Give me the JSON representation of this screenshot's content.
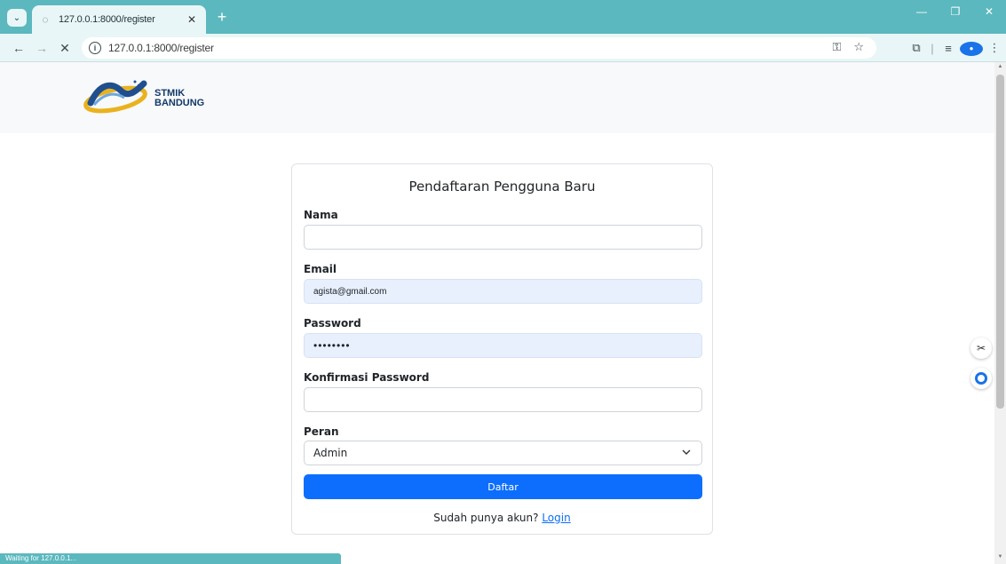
{
  "browser": {
    "tab_title": "127.0.0.1:8000/register",
    "url": "127.0.0.1:8000/register",
    "status_text": "Waiting for 127.0.0.1..."
  },
  "header": {
    "logo_line1": "STMIK",
    "logo_line2": "BANDUNG"
  },
  "form": {
    "title": "Pendaftaran Pengguna Baru",
    "name_label": "Nama",
    "name_value": "",
    "email_label": "Email",
    "email_value": "agista@gmail.com",
    "password_label": "Password",
    "password_value": "••••••••",
    "confirm_label": "Konfirmasi Password",
    "confirm_value": "",
    "role_label": "Peran",
    "role_value": "Admin",
    "submit_label": "Daftar",
    "footer_prefix": "Sudah punya akun? ",
    "login_link": "Login"
  },
  "colors": {
    "browser_accent": "#5bb8be",
    "primary": "#0d6efd",
    "autofill_bg": "#e8f0fe"
  },
  "icons": {
    "tab_favicon": "globe-icon",
    "back": "arrow-left-icon",
    "forward": "arrow-right-icon",
    "stop": "close-icon",
    "site_info": "info-icon",
    "password_key": "key-icon",
    "bookmark": "star-icon",
    "extensions": "puzzle-icon",
    "reading_list": "list-icon",
    "menu": "kebab-menu-icon",
    "scissors": "scissors-icon",
    "assistant": "ring-icon"
  }
}
